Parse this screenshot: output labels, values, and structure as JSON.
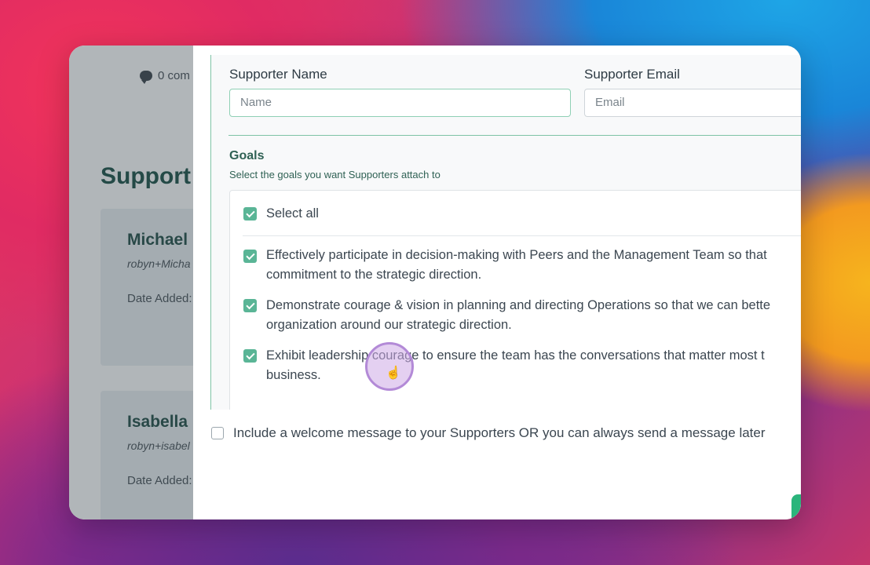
{
  "background_page": {
    "comments_label": "0 com",
    "heading": "Support",
    "cards": [
      {
        "name": "Michael",
        "email": "robyn+Micha",
        "date_label": "Date Added:"
      },
      {
        "name": "Isabella",
        "email": "robyn+isabel",
        "date_label": "Date Added:"
      }
    ]
  },
  "form": {
    "supporter_name_label": "Supporter Name",
    "supporter_name_placeholder": "Name",
    "supporter_email_label": "Supporter Email",
    "supporter_email_placeholder": "Email",
    "goals_title": "Goals",
    "goals_subtitle": "Select the goals you want Supporters attach to",
    "select_all_label": "Select all",
    "goals": [
      {
        "line1": "Effectively participate in decision-making with Peers and the Management Team so that",
        "line2": "commitment to the strategic direction.",
        "checked": true
      },
      {
        "line1": "Demonstrate courage & vision in planning and directing Operations so that we can bette",
        "line2": "organization around our strategic direction.",
        "checked": true
      },
      {
        "line1": "Exhibit leadership courage to ensure the team has the conversations that matter most t",
        "line2": "business.",
        "checked": true
      }
    ],
    "welcome_message_label": "Include a welcome message to your Supporters OR you can always send a message later"
  },
  "colors": {
    "accent_green": "#5ab596",
    "goals_text": "#2f6154",
    "heading_dark_green": "#10473f"
  }
}
